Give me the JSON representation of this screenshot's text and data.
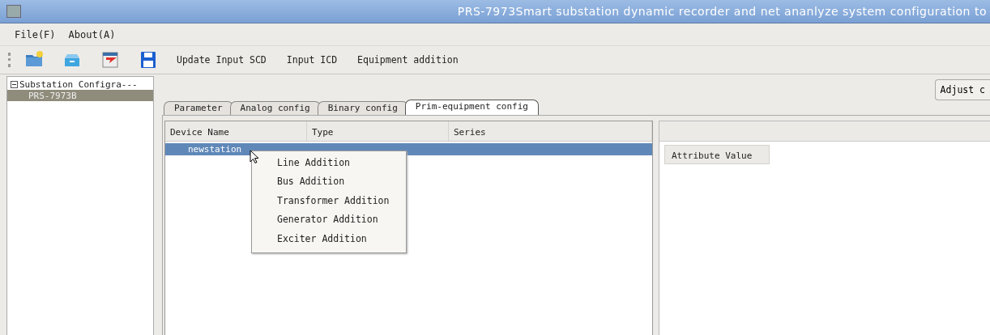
{
  "window": {
    "title": "PRS-7973Smart substation dynamic recorder and net ananlyze system configuration to"
  },
  "menu_bar": [
    "File(F)",
    "About(A)"
  ],
  "toolbar": {
    "icons": [
      {
        "kind": "new-folder"
      },
      {
        "kind": "tray"
      },
      {
        "kind": "import"
      },
      {
        "kind": "save"
      }
    ],
    "buttons": [
      "Update Input SCD",
      "Input ICD",
      "Equipment addition"
    ]
  },
  "sidebar": {
    "items": [
      {
        "label": "Substation Configra---",
        "expanded": true,
        "selected": false,
        "children": [
          {
            "label": "PRS-7973B",
            "selected": true
          }
        ]
      }
    ]
  },
  "adjust_button": "Adjust c",
  "tabs": [
    {
      "label": "Parameter",
      "selected": false
    },
    {
      "label": "Analog config",
      "selected": false
    },
    {
      "label": "Binary config",
      "selected": false
    },
    {
      "label": "Prim-equipment config",
      "selected": true
    }
  ],
  "device_table": {
    "columns": [
      "Device Name",
      "Type",
      "Series"
    ],
    "rows": [
      {
        "name": "newstation",
        "selected": true
      }
    ]
  },
  "attribute_panel": {
    "columns": [
      "Attribute Value"
    ]
  },
  "context_menu": [
    "Line Addition",
    "Bus Addition",
    "Transformer Addition",
    "Generator Addition",
    "Exciter Addition"
  ]
}
